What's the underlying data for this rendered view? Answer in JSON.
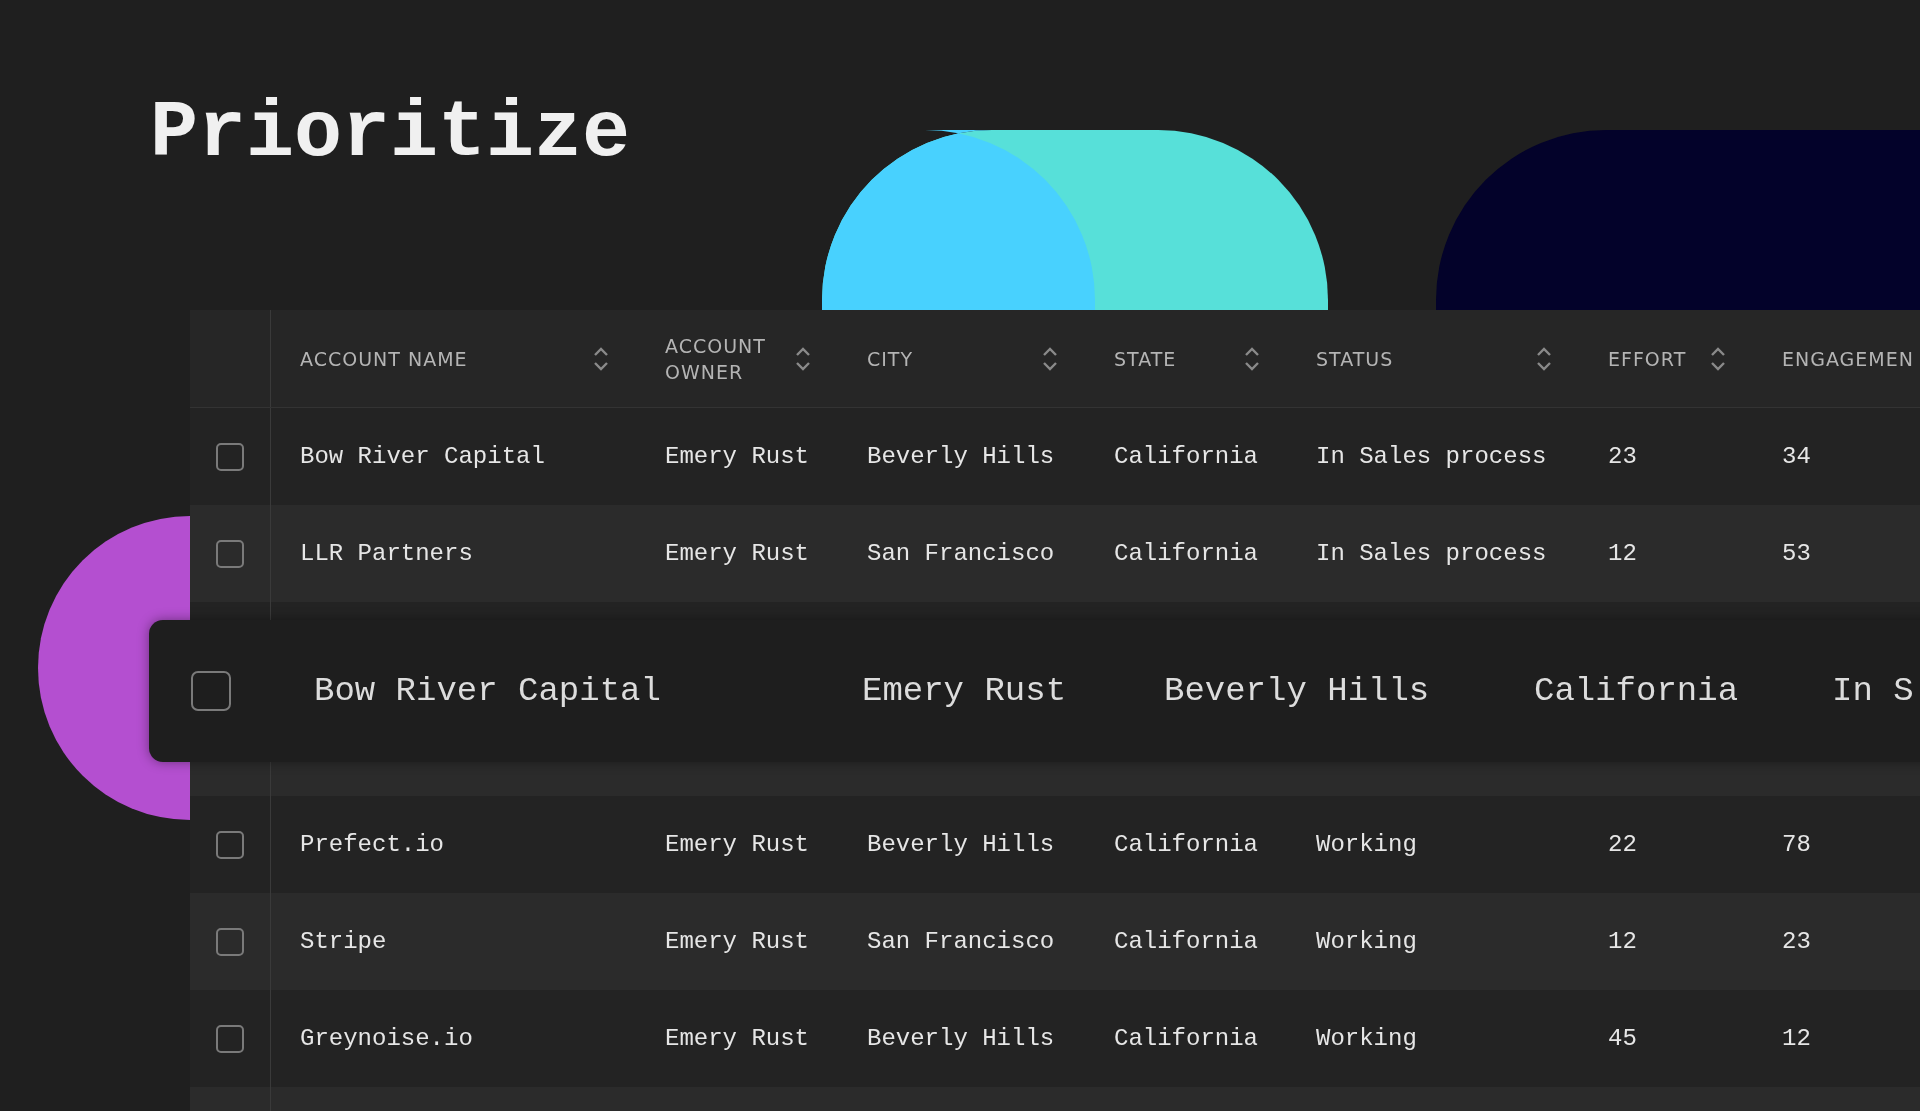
{
  "title": "Prioritize",
  "table": {
    "columns": [
      {
        "label": "ACCOUNT NAME",
        "sortable": true
      },
      {
        "label": "ACCOUNT OWNER",
        "sortable": true
      },
      {
        "label": "CITY",
        "sortable": true
      },
      {
        "label": "STATE",
        "sortable": true
      },
      {
        "label": "STATUS",
        "sortable": true
      },
      {
        "label": "EFFORT",
        "sortable": true
      },
      {
        "label": "ENGAGEMEN",
        "sortable": false
      }
    ],
    "rows": [
      {
        "checked": false,
        "cells": [
          "Bow River Capital",
          "Emery Rust",
          "Beverly Hills",
          "California",
          "In Sales process",
          "23",
          "34"
        ]
      },
      {
        "checked": false,
        "cells": [
          "LLR Partners",
          "Emery Rust",
          "San Francisco",
          "California",
          "In Sales process",
          "12",
          "53"
        ]
      },
      {
        "checked": false,
        "cells": [
          "Prefect.io",
          "Emery Rust",
          "Beverly Hills",
          "California",
          "Working",
          "22",
          "78"
        ]
      },
      {
        "checked": false,
        "cells": [
          "Stripe",
          "Emery Rust",
          "San Francisco",
          "California",
          "Working",
          "12",
          "23"
        ]
      },
      {
        "checked": false,
        "cells": [
          "Greynoise.io",
          "Emery Rust",
          "Beverly Hills",
          "California",
          "Working",
          "45",
          "12"
        ]
      }
    ],
    "floating_row": {
      "checked": false,
      "cells": [
        "Bow River Capital",
        "Emery Rust",
        "Beverly Hills",
        "California",
        "In S"
      ]
    }
  }
}
